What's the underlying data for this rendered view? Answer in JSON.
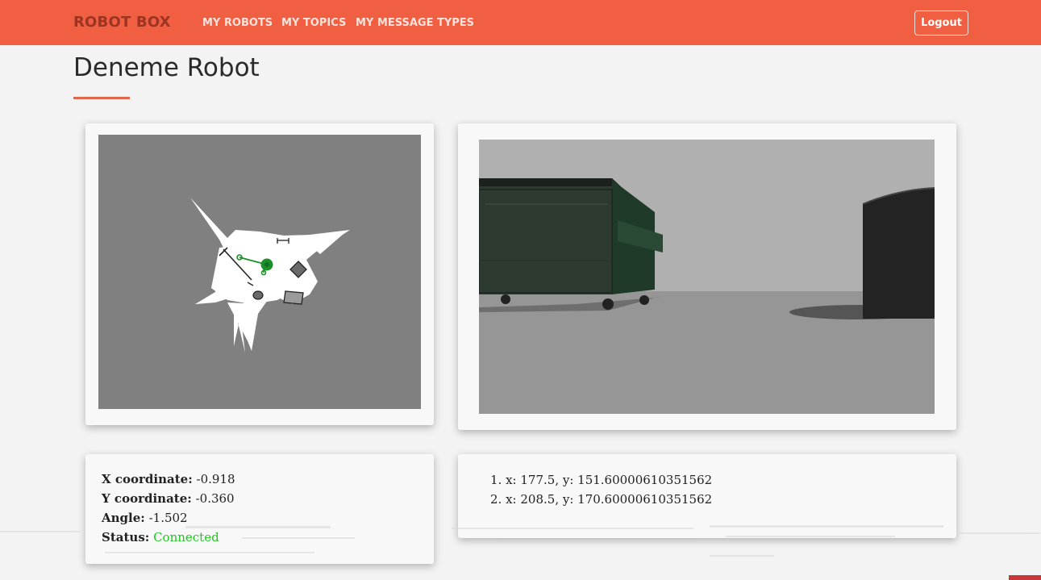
{
  "navbar": {
    "brand": "ROBOT BOX",
    "links": [
      "MY ROBOTS",
      "MY TOPICS",
      "MY MESSAGE TYPES"
    ],
    "logout_label": "Logout"
  },
  "page": {
    "title": "Deneme Robot"
  },
  "robot_info": {
    "x_label": "X coordinate:",
    "x_value": "-0.918",
    "y_label": "Y coordinate:",
    "y_value": "-0.360",
    "angle_label": "Angle:",
    "angle_value": "-1.502",
    "status_label": "Status:",
    "status_value": "Connected"
  },
  "points": [
    {
      "index": "1.",
      "text": "x: 177.5, y: 151.60000610351562"
    },
    {
      "index": "2.",
      "text": "x: 208.5, y: 170.60000610351562"
    }
  ],
  "colors": {
    "navbar": "#f15f42",
    "brand": "#9d3423",
    "accent_underline": "#e0664d",
    "status_connected": "#1bc91b",
    "map_unknown": "#808080",
    "map_free": "#ffffff",
    "robot_marker": "#1a8f2a"
  }
}
